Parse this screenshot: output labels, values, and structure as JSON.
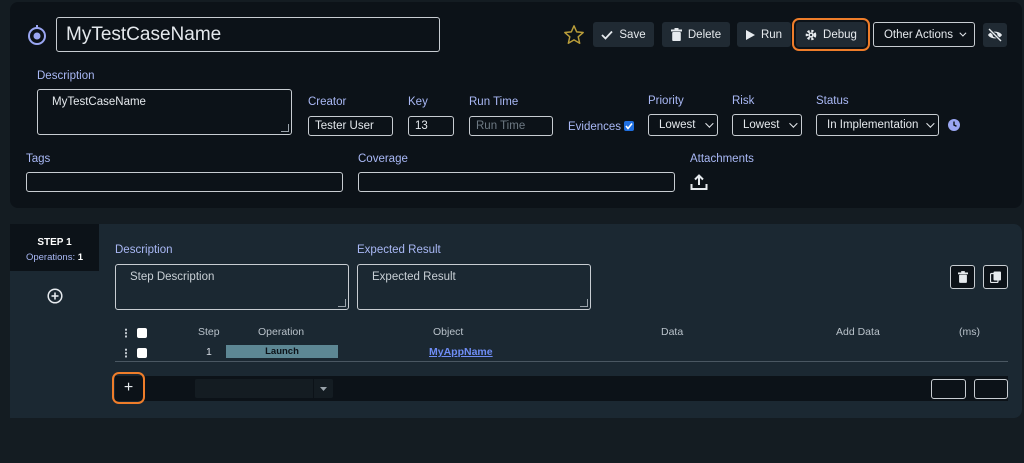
{
  "test_case": {
    "name": "MyTestCaseName",
    "description_label": "Description",
    "description_value": "MyTestCaseName",
    "creator_label": "Creator",
    "creator_value": "Tester User",
    "key_label": "Key",
    "key_value": "13",
    "runtime_label": "Run Time",
    "runtime_placeholder": "Run Time",
    "evidences_label": "Evidences",
    "priority_label": "Priority",
    "priority_value": "Lowest",
    "risk_label": "Risk",
    "risk_value": "Lowest",
    "status_label": "Status",
    "status_value": "In Implementation",
    "tags_label": "Tags",
    "coverage_label": "Coverage",
    "attachments_label": "Attachments"
  },
  "toolbar": {
    "save": "Save",
    "delete": "Delete",
    "run": "Run",
    "debug": "Debug",
    "other_actions": "Other Actions"
  },
  "step": {
    "title": "STEP 1",
    "operations_label": "Operations:",
    "operations_count": "1",
    "description_label": "Description",
    "description_placeholder": "Step Description",
    "expected_label": "Expected Result",
    "expected_placeholder": "Expected Result"
  },
  "operations_table": {
    "columns": [
      "Step",
      "Operation",
      "Object",
      "Data",
      "Add Data",
      "(ms)"
    ],
    "rows": [
      {
        "step": "1",
        "operation": "Launch",
        "object": "MyAppName",
        "data": "",
        "add_data": "",
        "ms": ""
      }
    ]
  },
  "add_row": {
    "plus": "+"
  },
  "colors": {
    "background": "#141c22",
    "panel": "#0c1218",
    "label": "#a9b8f5",
    "highlight": "#ef7d2a",
    "operation_cell": "#5d8794",
    "link": "#6f8df5"
  }
}
